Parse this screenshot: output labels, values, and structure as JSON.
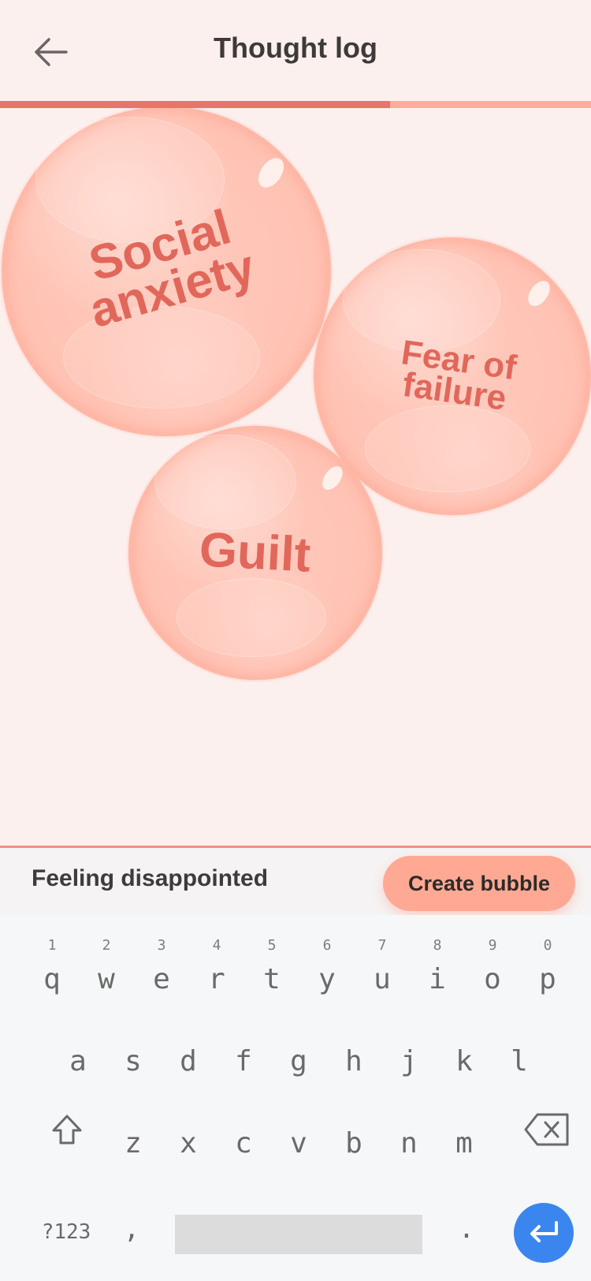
{
  "header": {
    "title": "Thought log",
    "back_icon": "arrow-left-icon",
    "progress": 0.66
  },
  "colors": {
    "background": "#fcf0ee",
    "accent": "#e8756a",
    "progress_track": "#ffad9a",
    "bubble_text": "#e2675b",
    "bubble_fill": "#ffc4b5",
    "button": "#ffa994",
    "enter_key": "#3a86ee"
  },
  "bubbles": [
    {
      "label_line1": "Social",
      "label_line2": "anxiety"
    },
    {
      "label_line1": "Fear of",
      "label_line2": "failure"
    },
    {
      "label_line1": "Guilt",
      "label_line2": ""
    }
  ],
  "input": {
    "value": "Feeling disappointed",
    "create_button_label": "Create bubble"
  },
  "keyboard": {
    "row1": [
      {
        "hint": "1",
        "key": "q"
      },
      {
        "hint": "2",
        "key": "w"
      },
      {
        "hint": "3",
        "key": "e"
      },
      {
        "hint": "4",
        "key": "r"
      },
      {
        "hint": "5",
        "key": "t"
      },
      {
        "hint": "6",
        "key": "y"
      },
      {
        "hint": "7",
        "key": "u"
      },
      {
        "hint": "8",
        "key": "i"
      },
      {
        "hint": "9",
        "key": "o"
      },
      {
        "hint": "0",
        "key": "p"
      }
    ],
    "row2": [
      "a",
      "s",
      "d",
      "f",
      "g",
      "h",
      "j",
      "k",
      "l"
    ],
    "row3": [
      "z",
      "x",
      "c",
      "v",
      "b",
      "n",
      "m"
    ],
    "symbols_label": "?123",
    "comma": ",",
    "period": ".",
    "shift_icon": "shift-icon",
    "backspace_icon": "backspace-icon",
    "enter_icon": "enter-icon"
  }
}
